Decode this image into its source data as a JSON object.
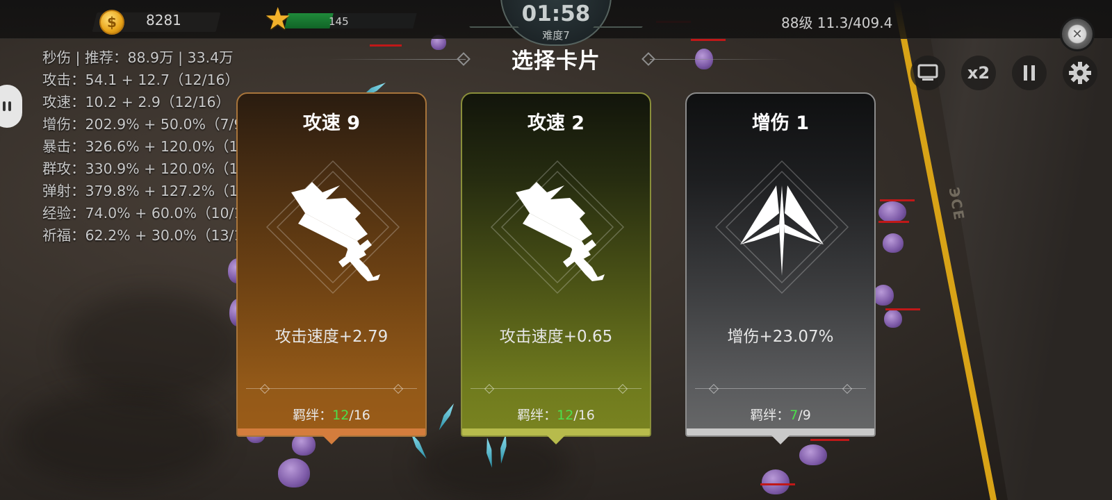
{
  "hud": {
    "coins": "8281",
    "xp_value": "145",
    "xp_progress": 0.35,
    "timer": "01:58",
    "difficulty": "难度7",
    "level_info": "88级 11.3/409.4",
    "speed_label": "x2"
  },
  "stats": [
    "秒伤 | 推荐：88.9万 | 33.4万",
    "攻击：54.1 + 12.7（12/16）",
    "攻速：10.2 + 2.9（12/16）",
    "增伤：202.9% + 50.0%（7/9",
    "暴击：326.6% + 120.0%（1",
    "群攻：330.9% + 120.0%（1",
    "弹射：379.8% + 127.2%（1",
    "经验：74.0% + 60.0%（10/1",
    "祈福：62.2% + 30.0%（13/1"
  ],
  "title": "选择卡片",
  "cards": [
    {
      "title": "攻速 9",
      "desc": "攻击速度+2.79",
      "bond_label": "羁绊：",
      "bond_current": "12",
      "bond_sep_max": "/16",
      "icon": "sword-icon",
      "accent": "#d47d3d"
    },
    {
      "title": "攻速 2",
      "desc": "攻击速度+0.65",
      "bond_label": "羁绊：",
      "bond_current": "12",
      "bond_sep_max": "/16",
      "icon": "sword-icon",
      "accent": "#b7bb4c"
    },
    {
      "title": "增伤 1",
      "desc": "增伤+23.07%",
      "bond_label": "羁绊：",
      "bond_current": "7",
      "bond_sep_max": "/9",
      "icon": "arrowhead-icon",
      "accent": "#c9c9c9"
    }
  ],
  "icons": [
    "coin-icon",
    "star-icon",
    "screen-icon",
    "pause-icon",
    "gear-icon",
    "close-icon",
    "chat-bubble-icon"
  ]
}
